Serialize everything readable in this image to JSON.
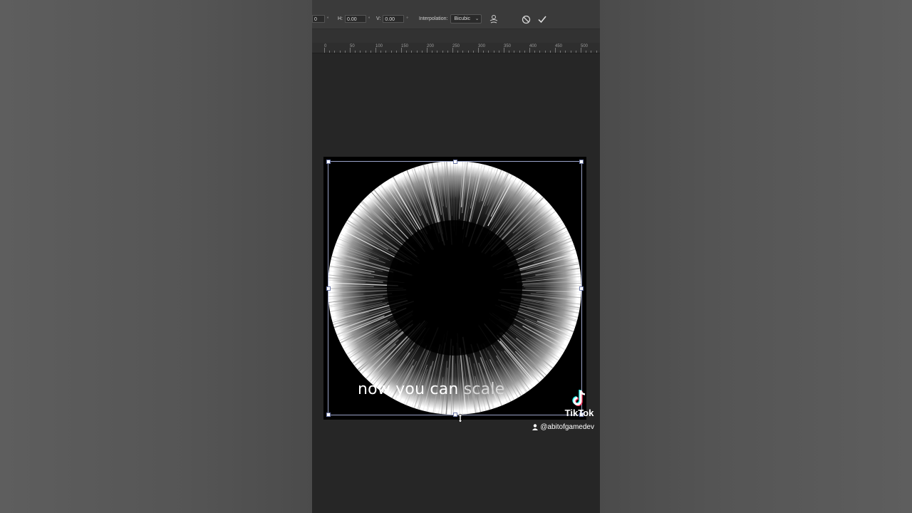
{
  "options_bar": {
    "w_value": "0",
    "w_unit": "°",
    "h_label": "H:",
    "h_value": "0.00",
    "h_unit": "°",
    "v_label": "V:",
    "v_value": "0.00",
    "v_unit": "°",
    "interpolation_label": "Interpolation:",
    "interpolation_value": "Bicubic",
    "warp_icon": "warp-puppet-icon",
    "cancel_icon": "cancel-icon",
    "commit_icon": "commit-check-icon"
  },
  "ruler": {
    "labels": [
      "0",
      "50",
      "100",
      "150",
      "200",
      "250",
      "300",
      "350",
      "400",
      "450",
      "500"
    ]
  },
  "video_overlay": {
    "caption_main": "now you can ",
    "caption_dim": "scale",
    "brand": "TikTok",
    "user_handle": "@abitofgamedev"
  },
  "colors": {
    "workspace": "#262626",
    "options_bar": "#3a3a3a",
    "bbox": "#9aa3c8",
    "tiktok_cyan": "#25F4EE",
    "tiktok_red": "#FE2C55"
  }
}
